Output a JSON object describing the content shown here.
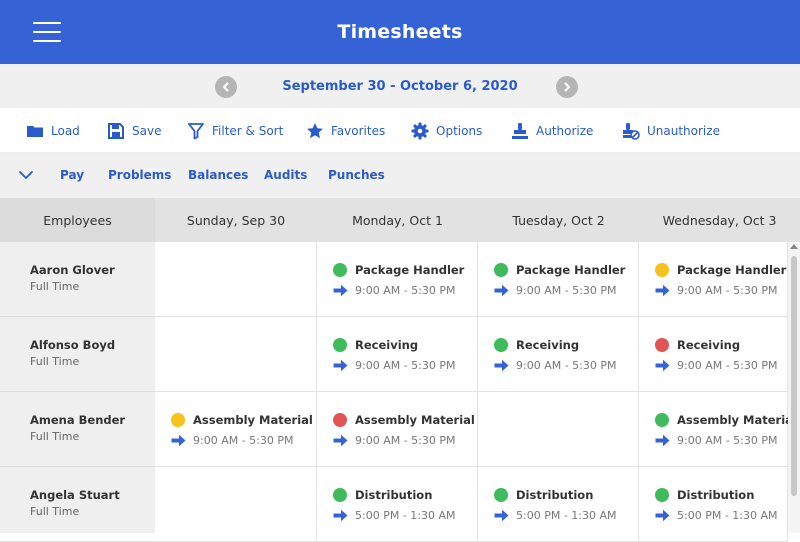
{
  "app": {
    "title": "Timesheets"
  },
  "date_nav": {
    "range": "September 30 - October 6, 2020",
    "prev_icon": "chevron-left-icon",
    "next_icon": "chevron-right-icon"
  },
  "toolbar": {
    "load": "Load",
    "save": "Save",
    "filter_sort": "Filter & Sort",
    "favorites": "Favorites",
    "options": "Options",
    "authorize": "Authorize",
    "unauthorize": "Unauthorize"
  },
  "subnav": {
    "tabs": [
      "Pay",
      "Problems",
      "Balances",
      "Audits",
      "Punches"
    ]
  },
  "grid": {
    "headers": [
      "Employees",
      "Sunday, Sep 30",
      "Monday, Oct 1",
      "Tuesday, Oct 2",
      "Wednesday, Oct 3"
    ],
    "employees": [
      {
        "name": "Aaron Glover",
        "type": "Full Time"
      },
      {
        "name": "Alfonso Boyd",
        "type": "Full Time"
      },
      {
        "name": "Amena Bender",
        "type": "Full Time"
      },
      {
        "name": "Angela Stuart",
        "type": "Full Time"
      }
    ],
    "status_colors": {
      "green": "#3fbb5c",
      "yellow": "#f6c21b",
      "red": "#e05454"
    },
    "accent": "#3563d6",
    "shifts": [
      [
        null,
        {
          "job": "Package Handler",
          "time": "9:00 AM -  5:30 PM",
          "status": "green"
        },
        {
          "job": "Package Handler",
          "time": "9:00 AM -  5:30 PM",
          "status": "green"
        },
        {
          "job": "Package Handler",
          "time": "9:00 AM -  5:30 PM",
          "status": "yellow"
        }
      ],
      [
        null,
        {
          "job": "Receiving",
          "time": "9:00 AM -  5:30 PM",
          "status": "green"
        },
        {
          "job": "Receiving",
          "time": "9:00 AM -  5:30 PM",
          "status": "green"
        },
        {
          "job": "Receiving",
          "time": "9:00 AM -  5:30 PM",
          "status": "red"
        }
      ],
      [
        {
          "job": "Assembly Material",
          "time": "9:00 AM -  5:30 PM",
          "status": "yellow"
        },
        {
          "job": "Assembly Material",
          "time": "9:00 AM -  5:30 PM",
          "status": "red"
        },
        null,
        {
          "job": "Assembly Material",
          "time": "9:00 AM -  5:30 PM",
          "status": "green"
        }
      ],
      [
        null,
        {
          "job": "Distribution",
          "time": "5:00 PM -  1:30 AM",
          "status": "green"
        },
        {
          "job": "Distribution",
          "time": "5:00 PM -  1:30 AM",
          "status": "green"
        },
        {
          "job": "Distribution",
          "time": "5:00 PM -  1:30 AM",
          "status": "green"
        }
      ]
    ]
  }
}
